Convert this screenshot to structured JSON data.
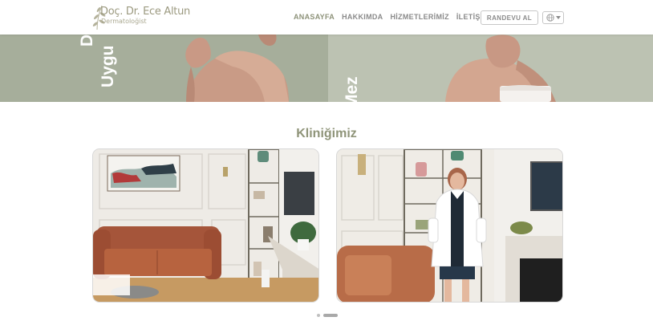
{
  "logo": {
    "name": "Doç. Dr. Ece Altun",
    "subtitle": "Dermatoloğist"
  },
  "nav": {
    "items": [
      {
        "label": "ANASAYFA",
        "active": true
      },
      {
        "label": "HAKKIMDA",
        "active": false
      },
      {
        "label": "HİZMETLERİMİZ",
        "active": false
      },
      {
        "label": "İLETİŞİM",
        "active": false
      }
    ],
    "appointment_label": "RANDEVU AL",
    "language_icon": "globe-icon"
  },
  "hero": {
    "left_line1": "D",
    "left_line2": "Uygu",
    "right_text": "Mez"
  },
  "section": {
    "title": "Kliniğimiz"
  },
  "slider": {
    "active_index": 1,
    "count": 2
  },
  "colors": {
    "accent": "#8f9479",
    "hero_left": "#a6ae9b",
    "hero_right": "#bcc2b2"
  }
}
